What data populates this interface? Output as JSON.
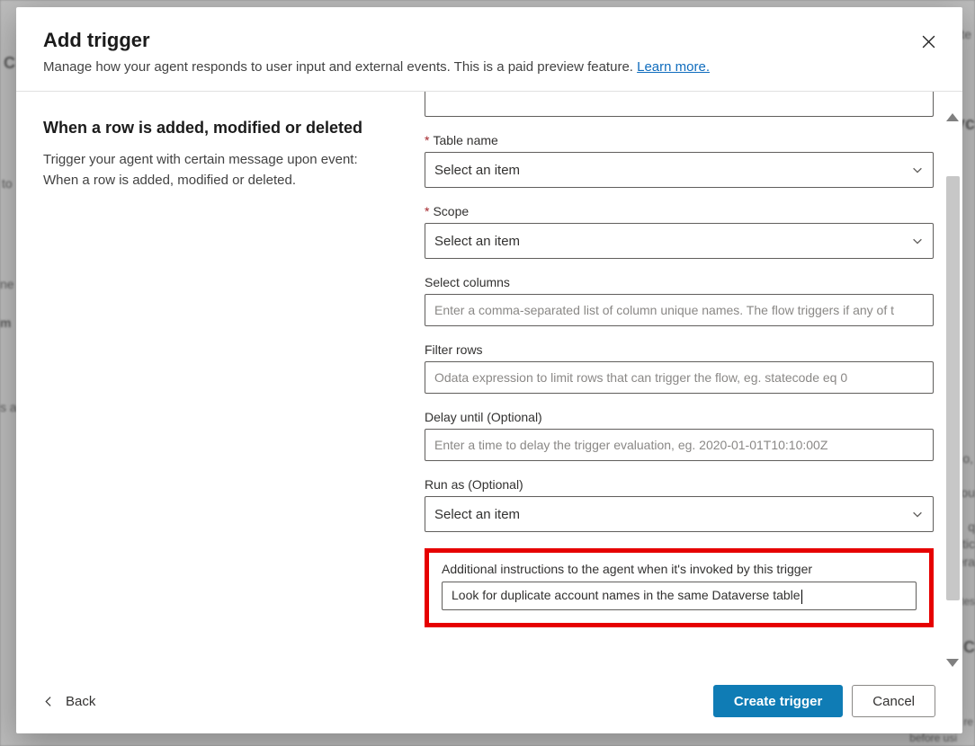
{
  "header": {
    "title": "Add trigger",
    "subtitle_pre": "Manage how your agent responds to user input and external events. This is a paid preview feature. ",
    "learn_more": "Learn more."
  },
  "left": {
    "title": "When a row is added, modified or deleted",
    "desc": "Trigger your agent with certain message upon event: When a row is added, modified or deleted."
  },
  "form": {
    "table_name": {
      "label": "Table name",
      "value": "Select an item"
    },
    "scope": {
      "label": "Scope",
      "value": "Select an item"
    },
    "select_columns": {
      "label": "Select columns",
      "placeholder": "Enter a comma-separated list of column unique names. The flow triggers if any of t"
    },
    "filter_rows": {
      "label": "Filter rows",
      "placeholder": "Odata expression to limit rows that can trigger the flow, eg. statecode eq 0"
    },
    "delay_until": {
      "label": "Delay until (Optional)",
      "placeholder": "Enter a time to delay the trigger evaluation, eg. 2020-01-01T10:10:00Z"
    },
    "run_as": {
      "label": "Run as (Optional)",
      "value": "Select an item"
    },
    "instructions": {
      "label": "Additional instructions to the agent when it's invoked by this trigger",
      "value": "Look for duplicate account names in the same Dataverse table"
    }
  },
  "footer": {
    "back": "Back",
    "create": "Create trigger",
    "cancel": "Cancel"
  },
  "backdrop": {
    "t1": "C",
    "t2": "to",
    "t3": "ne",
    "t4": "m",
    "t5": "s a",
    "r1": "te",
    "r2": "yc",
    "r3": "o,",
    "r4": "ou",
    "r5": "q",
    "r6": "tic",
    "r7": "era",
    "r8": "tes",
    "r9": "C",
    "b1": "re",
    "b2": "before usi"
  }
}
